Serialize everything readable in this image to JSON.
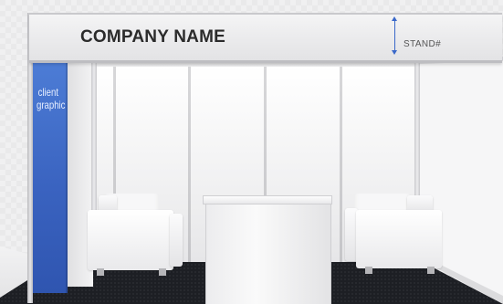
{
  "fascia": {
    "company_name": "COMPANY NAME",
    "stand_label": "STAND#"
  },
  "graphic": {
    "label": "client graphic"
  },
  "colors": {
    "graphic_blue": "#3a63c0",
    "dimension_marker": "#3a68c9",
    "carpet": "#1d1f24",
    "walls": "#f3f3f4"
  }
}
